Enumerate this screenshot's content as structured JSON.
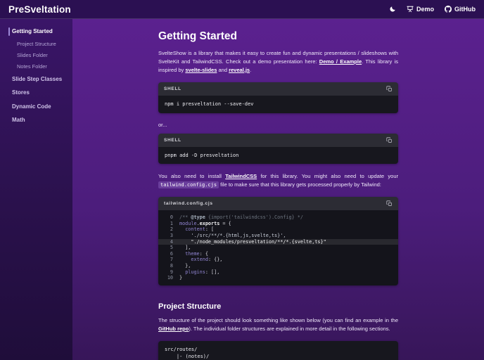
{
  "colors": {
    "header_bg": "#2b1052",
    "sidebar_bg_top": "#3a1568",
    "main_bg_top": "#5b218f",
    "main_bg_bottom": "#371659",
    "code_header_bg": "#2c2c34",
    "code_body_bg": "#17171e",
    "accent_bar": "#9c89d8"
  },
  "header": {
    "logo": "PreSveltation",
    "theme_toggle_icon": "moon-icon",
    "demo_icon": "presentation-icon",
    "demo_label": "Demo",
    "github_icon": "github-icon",
    "github_label": "GitHub"
  },
  "sidebar": {
    "items": [
      {
        "label": "Getting Started",
        "active": true,
        "children": [
          "Project Structure",
          "Slides Folder",
          "Notes Folder"
        ]
      },
      {
        "label": "Slide Step Classes",
        "active": false,
        "children": []
      },
      {
        "label": "Stores",
        "active": false,
        "children": []
      },
      {
        "label": "Dynamic Code",
        "active": false,
        "children": []
      },
      {
        "label": "Math",
        "active": false,
        "children": []
      }
    ]
  },
  "main": {
    "title": "Getting Started",
    "intro": {
      "part_a": "SvelteShow is a library that makes it easy to create fun and dynamic presentations / slideshows with SvelteKit and TailwindCSS. Check out a demo presentation here: ",
      "link_demo": "Demo / Example",
      "part_b": ". This library is inspired by ",
      "link_slides": "svelte-slides",
      "part_c": " and ",
      "link_reveal": "reveal.js",
      "part_d": "."
    },
    "shell_block_1": {
      "label": "SHELL",
      "code": "npm i presveltation --save-dev",
      "copy_icon": "copy-icon"
    },
    "or_text": "or...",
    "shell_block_2": {
      "label": "SHELL",
      "code": "pnpm add -D presveltation",
      "copy_icon": "copy-icon"
    },
    "tailwind_note": {
      "part_a": "You also need to install ",
      "link_tailwind": "TailwindCSS",
      "part_b": " for this library. You might also need to update your ",
      "inline_code": "tailwind.config.cjs",
      "part_c": " file to make sure that this library gets processed properly by Tailwind:"
    },
    "config_block": {
      "label": "tailwind.config.cjs",
      "copy_icon": "copy-icon",
      "highlighted_line": 4,
      "lines": [
        {
          "n": "0",
          "hl": false,
          "tokens": [
            {
              "t": "/** ",
              "c": "cm"
            },
            {
              "t": "@type",
              "c": "cmb"
            },
            {
              "t": " {import('tailwindcss').Config} */",
              "c": "cm"
            }
          ]
        },
        {
          "n": "1",
          "hl": false,
          "tokens": [
            {
              "t": "module",
              "c": "key"
            },
            {
              "t": ".",
              "c": "pun"
            },
            {
              "t": "exports",
              "c": "strong"
            },
            {
              "t": " = {",
              "c": "pun"
            }
          ]
        },
        {
          "n": "2",
          "hl": false,
          "tokens": [
            {
              "t": "  ",
              "c": "pun"
            },
            {
              "t": "content",
              "c": "key"
            },
            {
              "t": ": [",
              "c": "pun"
            }
          ]
        },
        {
          "n": "3",
          "hl": false,
          "tokens": [
            {
              "t": "    './src/**/*.{html,js,svelte,ts}',",
              "c": "str"
            }
          ]
        },
        {
          "n": "4",
          "hl": true,
          "tokens": [
            {
              "t": "    \"./node_modules/presveltation/**/*.{svelte,ts}\"",
              "c": "strw"
            }
          ]
        },
        {
          "n": "5",
          "hl": false,
          "tokens": [
            {
              "t": "  ],",
              "c": "pun"
            }
          ]
        },
        {
          "n": "6",
          "hl": false,
          "tokens": [
            {
              "t": "  ",
              "c": "pun"
            },
            {
              "t": "theme",
              "c": "key"
            },
            {
              "t": ": {",
              "c": "pun"
            }
          ]
        },
        {
          "n": "7",
          "hl": false,
          "tokens": [
            {
              "t": "    ",
              "c": "pun"
            },
            {
              "t": "extend",
              "c": "key"
            },
            {
              "t": ": {},",
              "c": "pun"
            }
          ]
        },
        {
          "n": "8",
          "hl": false,
          "tokens": [
            {
              "t": "  },",
              "c": "pun"
            }
          ]
        },
        {
          "n": "9",
          "hl": false,
          "tokens": [
            {
              "t": "  ",
              "c": "pun"
            },
            {
              "t": "plugins",
              "c": "key"
            },
            {
              "t": ": [],",
              "c": "pun"
            }
          ]
        },
        {
          "n": "10",
          "hl": false,
          "tokens": [
            {
              "t": "}",
              "c": "pun"
            }
          ]
        }
      ]
    },
    "section2_title": "Project Structure",
    "structure_note": {
      "part_a": "The structure of the project should look something like shown below (you can find an example in the ",
      "link_repo": "GitHub repo",
      "part_b": "). The individual folder structures are explained in more detail in the following sections."
    },
    "tree_block": {
      "lines": [
        "src/routes/",
        "    |- (notes)/"
      ]
    }
  }
}
